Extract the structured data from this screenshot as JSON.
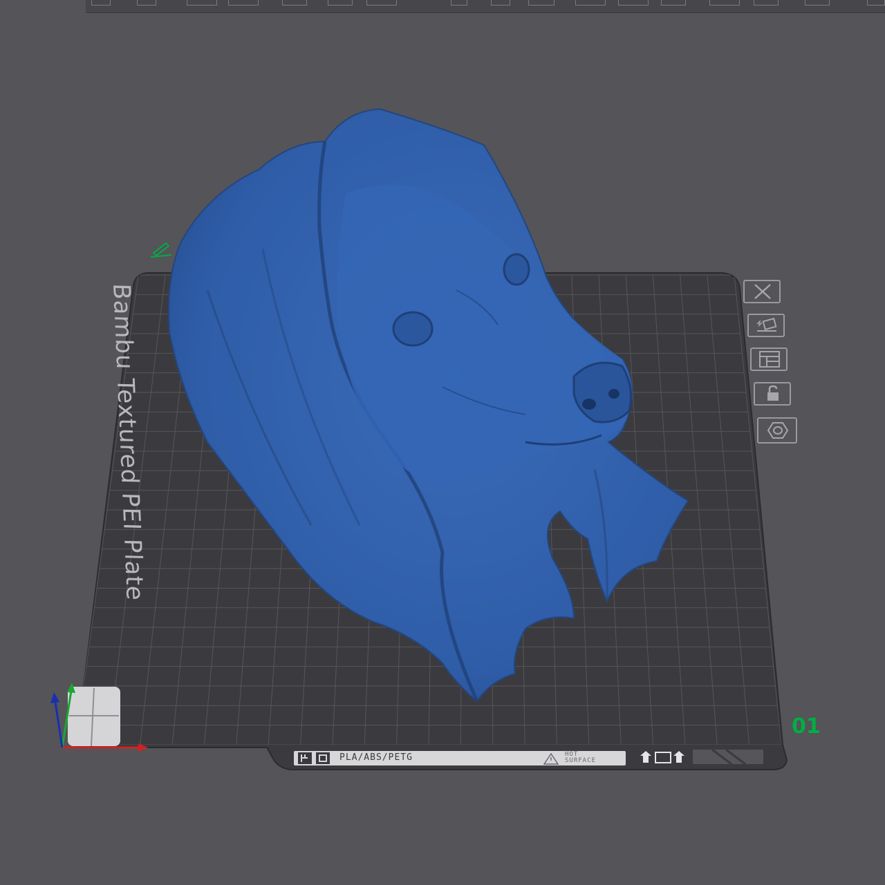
{
  "toolbar": {
    "description_items": 20
  },
  "plate": {
    "label": "Bambu Textured PEI Plate",
    "number": "01",
    "strip_text": "PLA/ABS/PETG",
    "hot_surface_line1": "HOT",
    "hot_surface_line2": "SURFACE"
  },
  "side_buttons": [
    {
      "name": "delete-plate-button",
      "icon": "close-icon"
    },
    {
      "name": "auto-arrange-button",
      "icon": "auto-orient-icon"
    },
    {
      "name": "arrange-button",
      "icon": "arrange-icon"
    },
    {
      "name": "lock-plate-button",
      "icon": "lock-icon"
    },
    {
      "name": "plate-settings-button",
      "icon": "gear-icon"
    }
  ],
  "colors": {
    "background": "#545459",
    "plate": "#3b3b3f",
    "model": "#2f5da8",
    "accent": "#00ae42"
  }
}
